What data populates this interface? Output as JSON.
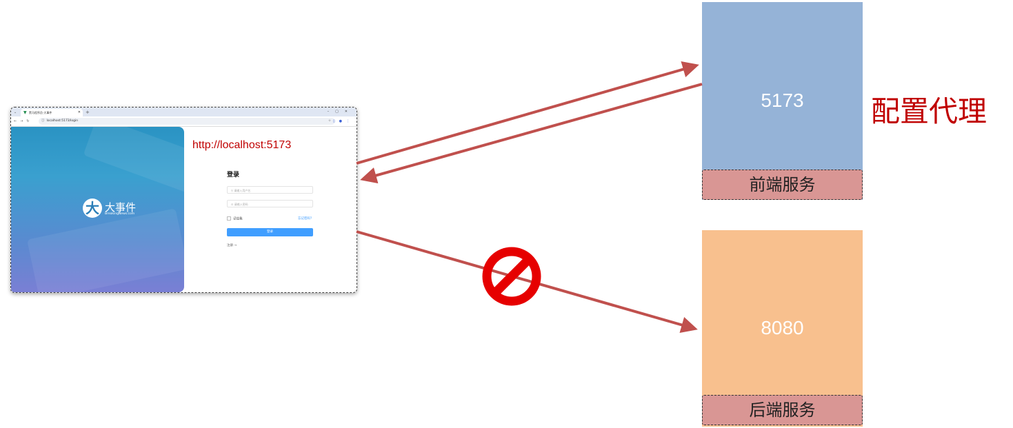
{
  "browser": {
    "tab_title": "黑马程序员-大事件",
    "url": "localhost:5173/login"
  },
  "login_page": {
    "logo_name": "大事件",
    "logo_sub": "BreakingNews.com",
    "title": "登录",
    "username_placeholder": "请输入用户名",
    "password_placeholder": "请输入密码",
    "remember_label": "记住我",
    "forgot_label": "忘记密码？",
    "login_button": "登录",
    "register_link": "注册 →"
  },
  "annotation": {
    "url_label": "http://localhost:5173",
    "proxy_label": "配置代理"
  },
  "frontend": {
    "port": "5173",
    "label": "前端服务"
  },
  "backend": {
    "port": "8080",
    "label": "后端服务"
  },
  "colors": {
    "arrow": "#c0504d",
    "forbidden": "#e60000",
    "frontend_box": "#95b3d7",
    "backend_box": "#f8c08e",
    "service_label": "#d99694",
    "annotation_text": "#c00000"
  }
}
